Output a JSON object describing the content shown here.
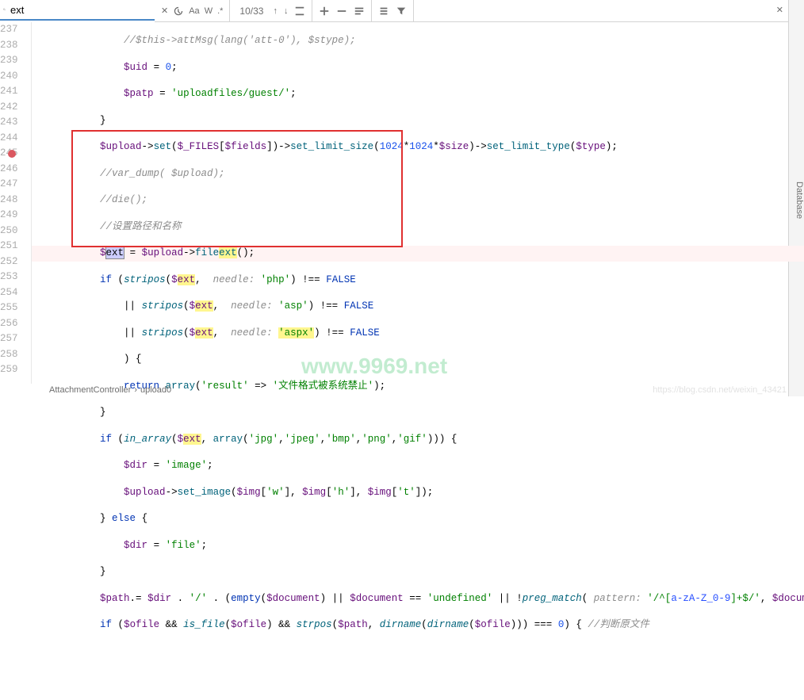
{
  "search": {
    "value": "ext",
    "case_label": "Aa",
    "word_label": "W",
    "regex_label": ".*",
    "match": "10/33"
  },
  "sidebar": {
    "right_label": "Database"
  },
  "lines": {
    "237": {
      "num": "237"
    },
    "238": {
      "num": "238"
    },
    "239": {
      "num": "239"
    },
    "240": {
      "num": "240"
    },
    "241": {
      "num": "241"
    },
    "242": {
      "num": "242"
    },
    "243": {
      "num": "243"
    },
    "244": {
      "num": "244"
    },
    "245": {
      "num": "245"
    },
    "246": {
      "num": "246"
    },
    "247": {
      "num": "247"
    },
    "248": {
      "num": "248"
    },
    "249": {
      "num": "249"
    },
    "250": {
      "num": "250"
    },
    "251": {
      "num": "251"
    },
    "252": {
      "num": "252"
    },
    "253": {
      "num": "253"
    },
    "254": {
      "num": "254"
    },
    "255": {
      "num": "255"
    },
    "256": {
      "num": "256"
    },
    "257": {
      "num": "257"
    },
    "258": {
      "num": "258"
    },
    "259": {
      "num": "259"
    }
  },
  "code": {
    "l237": "//$this->attMsg(lang('att-0'), $stype);",
    "l238_var": "$uid",
    "l238_eq": " = ",
    "l238_val": "0",
    "l238_semi": ";",
    "l239_var": "$patp",
    "l239_eq": " = ",
    "l239_str": "'uploadfiles/guest/'",
    "l239_semi": ";",
    "l240": "}",
    "l241_var1": "$upload",
    "l241_m1": "->",
    "l241_set": "set",
    "l241_p1": "(",
    "l241_files": "$_FILES",
    "l241_b1": "[",
    "l241_fields": "$fields",
    "l241_b2": "])->",
    "l241_sls": "set_limit_size",
    "l241_p2": "(",
    "l241_n1": "1024",
    "l241_s1": "*",
    "l241_n2": "1024",
    "l241_s2": "*",
    "l241_size": "$size",
    "l241_p3": ")->",
    "l241_slt": "set_limit_type",
    "l241_p4": "(",
    "l241_type": "$type",
    "l241_p5": ");",
    "l242": "//var_dump( $upload);",
    "l243": "//die();",
    "l244": "//设置路径和名称",
    "l245_var": "$",
    "l245_ext1": "ext",
    "l245_eq": " = ",
    "l245_up": "$upload",
    "l245_arr": "->",
    "l245_fn": "file",
    "l245_ext2": "ext",
    "l245_end": "();",
    "l246_if": "if",
    "l246_sp": " (",
    "l246_fn": "stripos",
    "l246_p1": "(",
    "l246_var": "$",
    "l246_ext": "ext",
    "l246_c": ",  ",
    "l246_needle": "needle: ",
    "l246_str": "'php'",
    "l246_p2": ") !== ",
    "l246_false": "FALSE",
    "l247_or": "|| ",
    "l247_fn": "stripos",
    "l247_p1": "(",
    "l247_var": "$",
    "l247_ext": "ext",
    "l247_c": ",  ",
    "l247_needle": "needle: ",
    "l247_str": "'asp'",
    "l247_p2": ") !== ",
    "l247_false": "FALSE",
    "l248_or": "|| ",
    "l248_fn": "stripos",
    "l248_p1": "(",
    "l248_var": "$",
    "l248_ext": "ext",
    "l248_c": ",  ",
    "l248_needle": "needle: ",
    "l248_str": "'aspx'",
    "l248_p2": ") !== ",
    "l248_false": "FALSE",
    "l249": ") {",
    "l250_ret": "return",
    "l250_sp": " ",
    "l250_fn": "array",
    "l250_p1": "(",
    "l250_k": "'result'",
    "l250_arr": " => ",
    "l250_v": "'文件格式被系统禁止'",
    "l250_p2": ");",
    "l251": "}",
    "l252_if": "if",
    "l252_sp": " (",
    "l252_fn": "in_array",
    "l252_p1": "(",
    "l252_var": "$",
    "l252_ext": "ext",
    "l252_c": ", ",
    "l252_arr": "array",
    "l252_p2": "(",
    "l252_s1": "'jpg'",
    "l252_c1": ",",
    "l252_s2": "'jpeg'",
    "l252_c2": ",",
    "l252_s3": "'bmp'",
    "l252_c3": ",",
    "l252_s4": "'png'",
    "l252_c4": ",",
    "l252_s5": "'gif'",
    "l252_p3": "))) {",
    "l253_var": "$dir",
    "l253_eq": " = ",
    "l253_str": "'image'",
    "l253_semi": ";",
    "l254_var": "$upload",
    "l254_arr": "->",
    "l254_fn": "set_image",
    "l254_p1": "(",
    "l254_img1": "$img",
    "l254_k1": "[",
    "l254_s1": "'w'",
    "l254_k1e": "], ",
    "l254_img2": "$img",
    "l254_k2": "[",
    "l254_s2": "'h'",
    "l254_k2e": "], ",
    "l254_img3": "$img",
    "l254_k3": "[",
    "l254_s3": "'t'",
    "l254_k3e": "]);",
    "l255_b": "} ",
    "l255_else": "else",
    "l255_b2": " {",
    "l256_var": "$dir",
    "l256_eq": " = ",
    "l256_str": "'file'",
    "l256_semi": ";",
    "l257": "}",
    "l258_var": "$path",
    "l258_d": ".= ",
    "l258_dir": "$dir",
    "l258_d2": " . ",
    "l258_sl": "'/'",
    "l258_d3": " . (",
    "l258_emp": "empty",
    "l258_p1": "(",
    "l258_doc": "$document",
    "l258_p2": ") || ",
    "l258_doc2": "$document",
    "l258_eq": " == ",
    "l258_undef": "'undefined'",
    "l258_or": " || !",
    "l258_pm": "preg_match",
    "l258_p3": "( ",
    "l258_pat": "pattern: ",
    "l258_reg1": "'/^[",
    "l258_reg2": "a-zA-Z_0-9",
    "l258_reg3": "]+$/'",
    "l258_c": ", ",
    "l258_doc3": "$documen",
    "l259_if": "if",
    "l259_sp": " (",
    "l259_of": "$ofile",
    "l259_and": " && ",
    "l259_isf": "is_file",
    "l259_p1": "(",
    "l259_of2": "$ofile",
    "l259_p2": ") && ",
    "l259_sp2": "strpos",
    "l259_p3": "(",
    "l259_path": "$path",
    "l259_c": ", ",
    "l259_dn": "dirname",
    "l259_p4": "(",
    "l259_dn2": "dirname",
    "l259_p5": "(",
    "l259_of3": "$ofile",
    "l259_p6": "))) === ",
    "l259_z": "0",
    "l259_p7": ") { ",
    "l259_cmt": "//判断原文件"
  },
  "breadcrumb": {
    "a": "AttachmentController",
    "b": "upload0"
  },
  "watermark": {
    "main": "www.9969.net",
    "csdn": "https://blog.csdn.net/weixin_43421"
  }
}
